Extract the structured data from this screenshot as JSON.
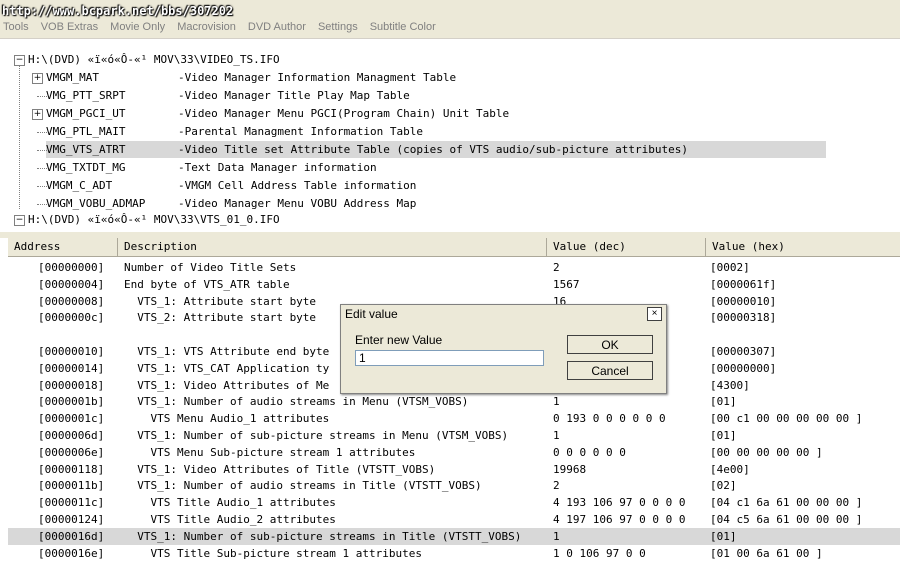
{
  "watermark": "http://www.bcpark.net/bbs/307202",
  "menu": [
    "Tools",
    "VOB Extras",
    "Movie Only",
    "Macrovision",
    "DVD Author",
    "Settings",
    "Subtitle Color"
  ],
  "tree": {
    "root1": "H:\\(DVD) «ï«ó«Ô-«¹ MOV\\33\\VIDEO_TS.IFO",
    "items": [
      {
        "name": "VMGM_MAT",
        "desc": "-Video Manager Information Managment Table",
        "expandable": true
      },
      {
        "name": "VMG_PTT_SRPT",
        "desc": "-Video Manager Title Play Map Table",
        "expandable": false
      },
      {
        "name": "VMGM_PGCI_UT",
        "desc": "-Video Manager Menu PGCI(Program Chain) Unit Table",
        "expandable": true
      },
      {
        "name": "VMG_PTL_MAIT",
        "desc": "-Parental Managment Information Table",
        "expandable": false
      },
      {
        "name": "VMG_VTS_ATRT",
        "desc": "-Video Title set Attribute Table (copies of VTS audio/sub-picture attributes)",
        "expandable": false,
        "selected": true
      },
      {
        "name": "VMG_TXTDT_MG",
        "desc": "-Text Data Manager information",
        "expandable": false
      },
      {
        "name": "VMGM_C_ADT",
        "desc": "-VMGM Cell Address Table information",
        "expandable": false
      },
      {
        "name": "VMGM_VOBU_ADMAP",
        "desc": "-Video Manager Menu VOBU Address Map",
        "expandable": false
      }
    ],
    "root2": "H:\\(DVD) «ï«ó«Ô-«¹ MOV\\33\\VTS_01_0.IFO"
  },
  "grid": {
    "headers": [
      "Address",
      "Description",
      "Value (dec)",
      "Value (hex)"
    ],
    "rows": [
      {
        "addr": "[00000000]",
        "desc": "Number of Video Title Sets",
        "dec": "2",
        "hex": "[0002]"
      },
      {
        "addr": "[00000004]",
        "desc": "End byte of VTS_ATR table",
        "dec": "1567",
        "hex": "[0000061f]"
      },
      {
        "addr": "[00000008]",
        "desc": "  VTS_1: Attribute start byte",
        "dec": "16",
        "hex": "[00000010]"
      },
      {
        "addr": "[0000000c]",
        "desc": "  VTS_2: Attribute start byte",
        "dec": "",
        "hex": "[00000318]"
      },
      {
        "addr": "",
        "desc": "",
        "dec": "",
        "hex": ""
      },
      {
        "addr": "[00000010]",
        "desc": "  VTS_1: VTS Attribute end byte",
        "dec": "",
        "hex": "[00000307]"
      },
      {
        "addr": "[00000014]",
        "desc": "  VTS_1: VTS_CAT Application ty",
        "dec": "",
        "hex": "[00000000]"
      },
      {
        "addr": "[00000018]",
        "desc": "  VTS_1: Video Attributes of Me",
        "dec": "",
        "hex": "[4300]"
      },
      {
        "addr": "[0000001b]",
        "desc": "  VTS_1: Number of audio streams in Menu (VTSM_VOBS)",
        "dec": "1",
        "hex": "[01]"
      },
      {
        "addr": "[0000001c]",
        "desc": "    VTS Menu Audio_1 attributes",
        "dec": "0 193 0 0 0 0 0 0",
        "hex": "[00 c1 00 00 00 00 00 ]"
      },
      {
        "addr": "[0000006d]",
        "desc": "  VTS_1: Number of sub-picture streams in Menu (VTSM_VOBS)",
        "dec": "1",
        "hex": "[01]"
      },
      {
        "addr": "[0000006e]",
        "desc": "    VTS Menu Sub-picture stream 1 attributes",
        "dec": "0 0 0 0 0 0",
        "hex": "[00 00 00 00 00 ]"
      },
      {
        "addr": "[00000118]",
        "desc": "  VTS_1: Video Attributes of Title (VTSTT_VOBS)",
        "dec": "19968",
        "hex": "[4e00]"
      },
      {
        "addr": "[0000011b]",
        "desc": "  VTS_1: Number of audio streams in Title (VTSTT_VOBS)",
        "dec": "2",
        "hex": "[02]"
      },
      {
        "addr": "[0000011c]",
        "desc": "    VTS Title Audio_1 attributes",
        "dec": "4 193 106 97 0 0 0 0",
        "hex": "[04 c1 6a 61 00 00 00 ]"
      },
      {
        "addr": "[00000124]",
        "desc": "    VTS Title Audio_2 attributes",
        "dec": "4 197 106 97 0 0 0 0",
        "hex": "[04 c5 6a 61 00 00 00 ]"
      },
      {
        "addr": "[0000016d]",
        "desc": "  VTS_1: Number of sub-picture streams in Title (VTSTT_VOBS)",
        "dec": "1",
        "hex": "[01]",
        "selected": true
      },
      {
        "addr": "[0000016e]",
        "desc": "    VTS Title Sub-picture stream 1 attributes",
        "dec": "1 0 106 97 0 0",
        "hex": "[01 00 6a 61 00 ]"
      }
    ]
  },
  "dialog": {
    "title": "Edit value",
    "close": "×",
    "label": "Enter new Value",
    "value": "1",
    "ok": "OK",
    "cancel": "Cancel"
  }
}
